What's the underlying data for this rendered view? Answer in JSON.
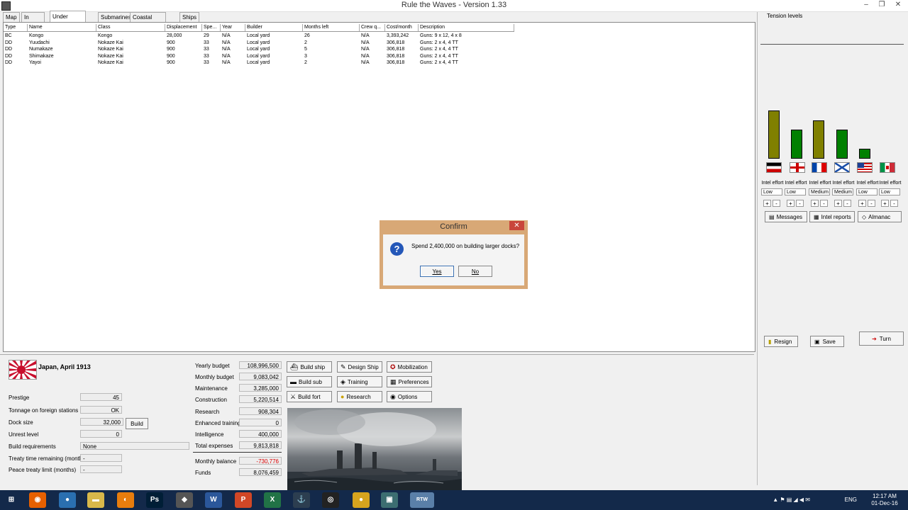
{
  "window": {
    "title": "Rule the Waves - Version 1.33",
    "controls": {
      "minimize": "–",
      "restore": "❐",
      "close": "✕"
    }
  },
  "tabs": [
    "Map",
    "In service",
    "Under construction",
    "Submarines",
    "Coastal fortifications",
    "Ships sunk"
  ],
  "table": {
    "columns": [
      "Type",
      "Name",
      "Class",
      "Displacement",
      "Spe...",
      "Year",
      "Builder",
      "Months left",
      "Crew q...",
      "Cost/month",
      "Description"
    ],
    "rows": [
      [
        "BC",
        "Kongo",
        "Kongo",
        "28,000",
        "29",
        "N/A",
        "Local yard",
        "26",
        "N/A",
        "3,393,242",
        "Guns: 9 x 12, 4 x 8"
      ],
      [
        "DD",
        "Yuudachi",
        "Nokaze Kai",
        "900",
        "33",
        "N/A",
        "Local yard",
        "2",
        "N/A",
        "306,818",
        "Guns: 2 x 4, 4 TT"
      ],
      [
        "DD",
        "Numakaze",
        "Nokaze Kai",
        "900",
        "33",
        "N/A",
        "Local yard",
        "5",
        "N/A",
        "306,818",
        "Guns: 2 x 4, 4 TT"
      ],
      [
        "DD",
        "Shimakaze",
        "Nokaze Kai",
        "900",
        "33",
        "N/A",
        "Local yard",
        "3",
        "N/A",
        "306,818",
        "Guns: 2 x 4, 4 TT"
      ],
      [
        "DD",
        "Yayoi",
        "Nokaze Kai",
        "900",
        "33",
        "N/A",
        "Local yard",
        "2",
        "N/A",
        "306,818",
        "Guns: 2 x 4, 4 TT"
      ]
    ]
  },
  "tension": {
    "title": "Tension levels",
    "bars": [
      {
        "level": 0.75,
        "color": "#808000"
      },
      {
        "level": 0.45,
        "color": "#008000"
      },
      {
        "level": 0.6,
        "color": "#808000"
      },
      {
        "level": 0.45,
        "color": "#008000"
      },
      {
        "level": 0.15,
        "color": "#008000"
      },
      {
        "level": 0,
        "color": "#008000"
      }
    ],
    "flags": [
      "germany-flag",
      "uk-flag",
      "france-flag",
      "russia-flag",
      "usa-flag",
      "italy-flag"
    ],
    "intel": [
      {
        "label": "Intel effort",
        "value": "Low"
      },
      {
        "label": "Intel effort",
        "value": "Low"
      },
      {
        "label": "Intel effort",
        "value": "Medium"
      },
      {
        "label": "Intel effort",
        "value": "Medium"
      },
      {
        "label": "Intel effort",
        "value": "Low"
      },
      {
        "label": "Intel effort",
        "value": "Low"
      }
    ],
    "plus": "+",
    "minus": "-"
  },
  "right_buttons": {
    "messages": "Messages",
    "intel_reports": "Intel reports",
    "almanac": "Almanac",
    "resign": "Resign",
    "save": "Save",
    "turn": "Turn"
  },
  "nation": {
    "title": "Japan, April 1913"
  },
  "stats": [
    {
      "label": "Prestige",
      "value": "45"
    },
    {
      "label": "Tonnage on foreign stations",
      "value": "OK"
    },
    {
      "label": "Dock size",
      "value": "32,000"
    },
    {
      "label": "Unrest level",
      "value": "0"
    },
    {
      "label": "Build requirements",
      "value": "None"
    },
    {
      "label": "Treaty time remaining (months)",
      "value": "-"
    },
    {
      "label": "Peace treaty limit (months)",
      "value": "-"
    }
  ],
  "build_button": "Build",
  "budget": [
    {
      "label": "Yearly budget",
      "value": "108,996,500"
    },
    {
      "label": "Monthly budget",
      "value": "9,083,042"
    },
    {
      "label": "Maintenance",
      "value": "3,285,000"
    },
    {
      "label": "Construction",
      "value": "5,220,514"
    },
    {
      "label": "Research",
      "value": "908,304"
    },
    {
      "label": "Enhanced training",
      "value": "0"
    },
    {
      "label": "Intelligence",
      "value": "400,000"
    },
    {
      "label": "Total expenses",
      "value": "9,813,818"
    },
    {
      "label": "Monthly balance",
      "value": "-730,776"
    },
    {
      "label": "Funds",
      "value": "8,076,459"
    }
  ],
  "actions": {
    "build_ship": "Build ship",
    "design_ship": "Design Ship",
    "mobilization": "Mobilization",
    "build_sub": "Build sub",
    "training": "Training",
    "preferences": "Preferences",
    "build_fort": "Build fort",
    "research": "Research",
    "options": "Options"
  },
  "dialog": {
    "title": "Confirm",
    "message": "Spend 2,400,000 on building larger docks?",
    "yes": "Yes",
    "no": "No",
    "close": "✕",
    "icon": "?"
  },
  "taskbar": {
    "tray_lang": "ENG",
    "time": "12:17 AM",
    "date": "01-Dec-16",
    "apps": [
      {
        "name": "windows-start-icon",
        "glyph": "⊞",
        "color": "#13294a"
      },
      {
        "name": "firefox-icon",
        "glyph": "◉",
        "color": "#e66000"
      },
      {
        "name": "app-icon",
        "glyph": "●",
        "color": "#2a6fb0"
      },
      {
        "name": "file-explorer-icon",
        "glyph": "▬",
        "color": "#d8b84a"
      },
      {
        "name": "blender-icon",
        "glyph": "◐",
        "color": "#e87d0d"
      },
      {
        "name": "photoshop-icon",
        "glyph": "Ps",
        "color": "#001e36"
      },
      {
        "name": "app-icon-2",
        "glyph": "◆",
        "color": "#555555"
      },
      {
        "name": "word-icon",
        "glyph": "W",
        "color": "#2b579a"
      },
      {
        "name": "powerpoint-icon",
        "glyph": "P",
        "color": "#d24726"
      },
      {
        "name": "excel-icon",
        "glyph": "X",
        "color": "#217346"
      },
      {
        "name": "world-of-warships-icon",
        "glyph": "⚓",
        "color": "#2c3e50"
      },
      {
        "name": "app-icon-3",
        "glyph": "◎",
        "color": "#222222"
      },
      {
        "name": "app-icon-4",
        "glyph": "●",
        "color": "#d6a41e"
      },
      {
        "name": "app-icon-5",
        "glyph": "▣",
        "color": "#3c6e71"
      },
      {
        "name": "rtw-icon",
        "glyph": "RTW",
        "color": "#5a7fa8"
      }
    ]
  }
}
